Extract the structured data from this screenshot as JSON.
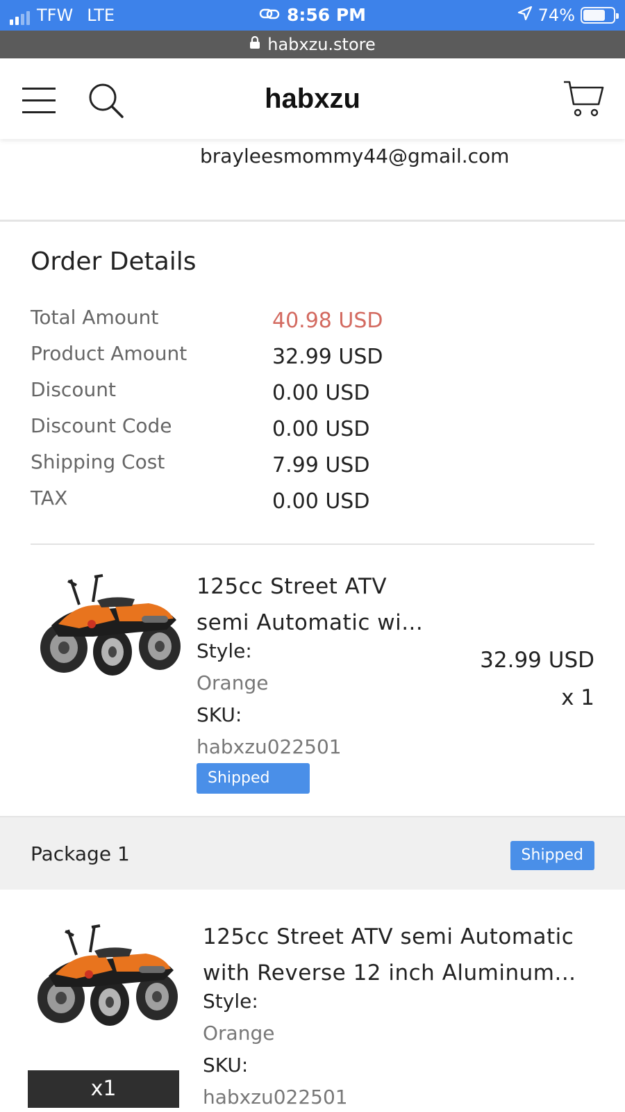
{
  "status_bar": {
    "carrier": "TFW",
    "network": "LTE",
    "time": "8:56 PM",
    "battery": "74%",
    "battery_level": 0.74,
    "signal_bars_active": 2,
    "signal_bars_total": 4,
    "bar_color": "#3d82ea"
  },
  "browser": {
    "url": "habxzu.store"
  },
  "header": {
    "brand": "habxzu"
  },
  "email": "brayleesmommy44@gmail.com",
  "order_details": {
    "title": "Order Details",
    "rows": [
      {
        "label": "Total Amount",
        "value": "40.98 USD"
      },
      {
        "label": "Product Amount",
        "value": "32.99 USD"
      },
      {
        "label": "Discount",
        "value": "0.00 USD"
      },
      {
        "label": "Discount Code",
        "value": "0.00 USD"
      },
      {
        "label": "Shipping Cost",
        "value": "7.99 USD"
      },
      {
        "label": "TAX",
        "value": "0.00 USD"
      }
    ],
    "total_color": "#d36a60"
  },
  "item": {
    "title_line1": "125cc Street ATV",
    "title_line2": "semi Automatic wi...",
    "style_label": "Style:",
    "style_value": "Orange",
    "sku_label": "SKU:",
    "sku_value": "habxzu022501",
    "status": "Shipped",
    "price": "32.99 USD",
    "qty": "x 1"
  },
  "package": {
    "label": "Package 1",
    "status": "Shipped",
    "item": {
      "title_line1": "125cc Street ATV semi Automatic",
      "title_line2": "with Reverse 12 inch Aluminum...",
      "style_label": "Style:",
      "style_value": "Orange",
      "sku_label": "SKU:",
      "sku_value": "habxzu022501",
      "qty": "x1"
    }
  },
  "colors": {
    "badge": "#4a8fe8",
    "accent_orange": "#e8741e"
  }
}
